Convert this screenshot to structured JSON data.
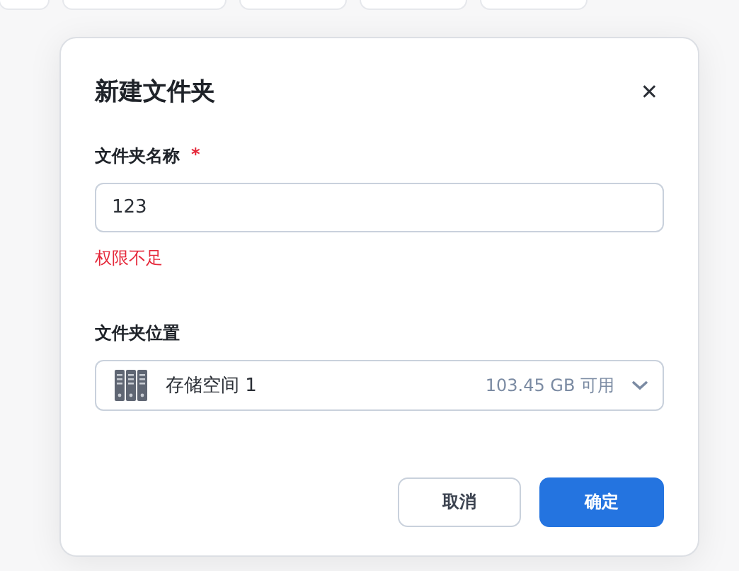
{
  "dialog": {
    "title": "新建文件夹",
    "close": "✕",
    "name_field": {
      "label": "文件夹名称",
      "required_mark": "*",
      "value": "123",
      "error": "权限不足"
    },
    "location_field": {
      "label": "文件夹位置",
      "value": "存储空间 1",
      "free_space": "103.45 GB 可用"
    },
    "buttons": [
      {
        "label": "取消",
        "kind": "secondary"
      },
      {
        "label": "确定",
        "kind": "primary"
      }
    ]
  }
}
